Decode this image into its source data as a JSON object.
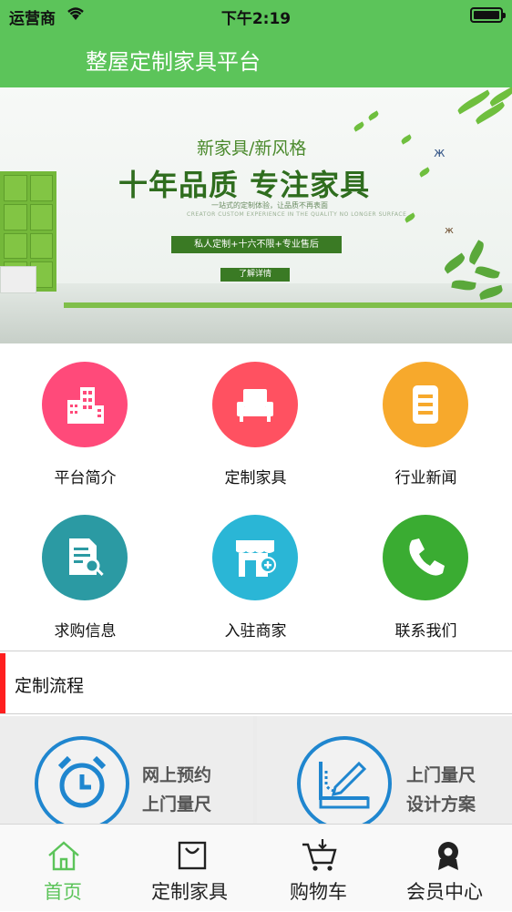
{
  "status_bar": {
    "carrier": "运营商",
    "time": "下午2:19"
  },
  "nav": {
    "title": "整屋定制家具平台"
  },
  "banner": {
    "subtitle": "新家具/新风格",
    "headline": "十年品质 专注家具",
    "tagline": "一站式的定制体验，让品质不再表面",
    "tagline_en": "CREATOR CUSTOM EXPERIENCE IN THE QUALITY NO LONGER SURFACE",
    "slogan": "私人定制+十六不限+专业售后",
    "cta": "了解详情"
  },
  "menu": [
    {
      "label": "平台简介",
      "color": "#ff4a7a",
      "icon": "building-icon"
    },
    {
      "label": "定制家具",
      "color": "#ff5161",
      "icon": "sofa-icon"
    },
    {
      "label": "行业新闻",
      "color": "#f7a92c",
      "icon": "document-icon"
    },
    {
      "label": "求购信息",
      "color": "#2b9aa3",
      "icon": "document-search-icon"
    },
    {
      "label": "入驻商家",
      "color": "#2ab6d6",
      "icon": "store-add-icon"
    },
    {
      "label": "联系我们",
      "color": "#3aac32",
      "icon": "phone-icon"
    }
  ],
  "section": {
    "title": "定制流程"
  },
  "process": [
    {
      "line1": "网上预约",
      "line2": "上门量尺",
      "icon": "clock-icon"
    },
    {
      "line1": "上门量尺",
      "line2": "设计方案",
      "icon": "ruler-pen-icon"
    }
  ],
  "tabs": [
    {
      "label": "首页",
      "icon": "home-icon",
      "active": true
    },
    {
      "label": "定制家具",
      "icon": "bag-icon",
      "active": false
    },
    {
      "label": "购物车",
      "icon": "cart-icon",
      "active": false
    },
    {
      "label": "会员中心",
      "icon": "member-icon",
      "active": false
    }
  ],
  "colors": {
    "brand": "#5cc45a",
    "active_tab": "#5cc45a",
    "accent_bar": "#ff1f1f",
    "process_ring": "#1f86cf"
  }
}
